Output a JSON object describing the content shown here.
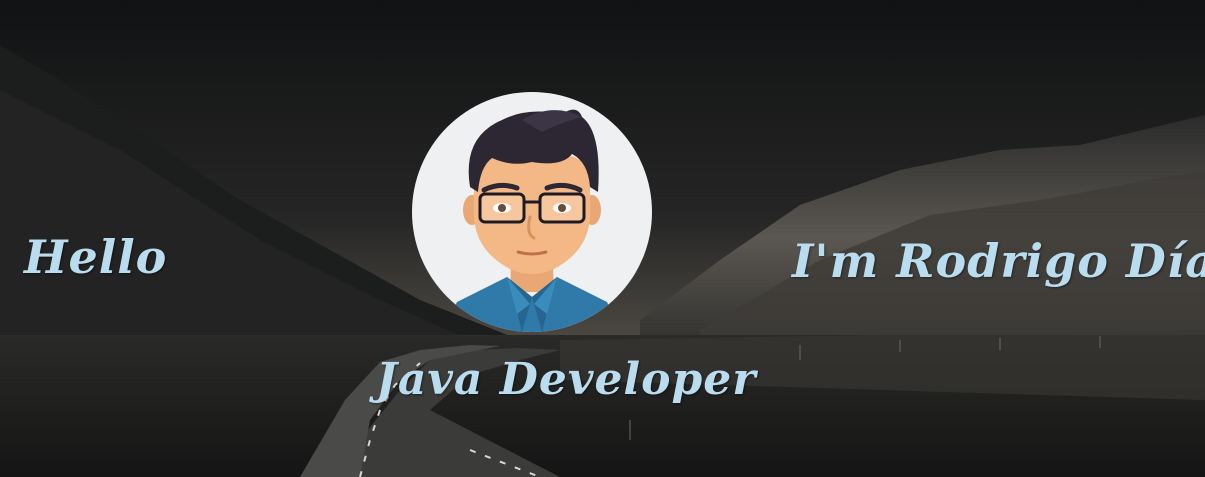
{
  "hero": {
    "greeting": "Hello",
    "intro_name": "I'm Rodrigo Díaz",
    "role": "Java Developer",
    "text_color": "#b9dcee"
  },
  "avatar": {
    "icon": "developer-avatar-icon",
    "background_color": "#eef0f1",
    "shirt_color": "#2f7aa8"
  },
  "background": {
    "icon": "mountain-road-landscape"
  }
}
